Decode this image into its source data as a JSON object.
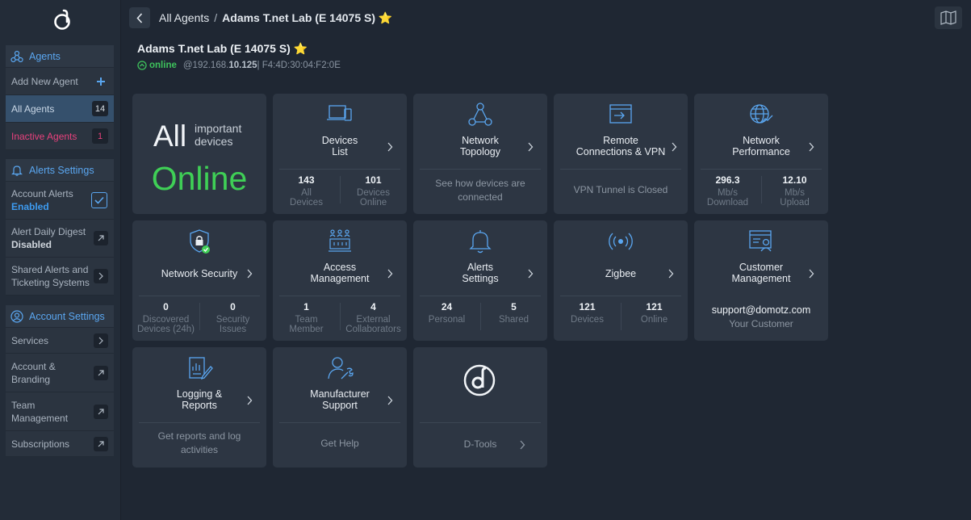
{
  "header": {
    "crumb_root": "All Agents",
    "crumb_sep": "/",
    "crumb_current": "Adams T.net Lab (E 14075 S) ⭐"
  },
  "agent": {
    "title": "Adams T.net Lab (E 14075 S) ⭐",
    "status": "online",
    "ip_prefix": "@192.168.",
    "ip_suffix": "10.125",
    "mac": " | F4:4D:30:04:F2:0E"
  },
  "sidebar": {
    "agents_header": "Agents",
    "add_new_agent": "Add New Agent",
    "all_agents": "All Agents",
    "all_agents_count": "14",
    "inactive_agents": "Inactive Agents",
    "inactive_agents_count": "1",
    "alerts_header": "Alerts Settings",
    "account_alerts": "Account Alerts",
    "account_alerts_state": "Enabled",
    "alert_digest": "Alert Daily Digest",
    "alert_digest_state": "Disabled",
    "shared_alerts_1": "Shared Alerts and",
    "shared_alerts_2": "Ticketing Systems",
    "account_header": "Account Settings",
    "services": "Services",
    "account_branding_1": "Account &",
    "account_branding_2": "Branding",
    "team_mgmt_1": "Team",
    "team_mgmt_2": "Management",
    "subscriptions": "Subscriptions"
  },
  "summary": {
    "all": "All",
    "important_1": "important",
    "important_2": "devices",
    "online": "Online"
  },
  "cards": {
    "devices": {
      "l1": "Devices",
      "l2": "List",
      "s1n": "143",
      "s1a": "All",
      "s1b": "Devices",
      "s2n": "101",
      "s2a": "Devices",
      "s2b": "Online"
    },
    "topology": {
      "l1": "Network",
      "l2": "Topology",
      "n1": "See how devices are",
      "n2": "connected"
    },
    "remote": {
      "l1": "Remote",
      "l2": "Connections & VPN",
      "n1": "VPN Tunnel is Closed"
    },
    "performance": {
      "l1": "Network",
      "l2": "Performance",
      "s1n": "296.3",
      "s1a": "Mb/s",
      "s1b": "Download",
      "s2n": "12.10",
      "s2a": "Mb/s",
      "s2b": "Upload"
    },
    "security": {
      "l1": "Network Security",
      "s1n": "0",
      "s1a": "Discovered",
      "s1b": "Devices (24h)",
      "s2n": "0",
      "s2a": "Security",
      "s2b": "Issues"
    },
    "access": {
      "l1": "Access",
      "l2": "Management",
      "s1n": "1",
      "s1a": "Team",
      "s1b": "Member",
      "s2n": "4",
      "s2a": "External",
      "s2b": "Collaborators"
    },
    "alerts": {
      "l1": "Alerts",
      "l2": "Settings",
      "s1n": "24",
      "s1a": "Personal",
      "s2n": "5",
      "s2a": "Shared"
    },
    "zigbee": {
      "l1": "Zigbee",
      "s1n": "121",
      "s1a": "Devices",
      "s2n": "121",
      "s2a": "Online"
    },
    "customer": {
      "l1": "Customer",
      "l2": "Management",
      "n1": "support@domotz.com",
      "n2": "Your Customer"
    },
    "logging": {
      "l1": "Logging &",
      "l2": "Reports",
      "n1": "Get reports and log",
      "n2": "activities"
    },
    "manufacturer": {
      "l1": "Manufacturer",
      "l2": "Support",
      "n1": "Get Help"
    },
    "dtools": {
      "n1": "D-Tools"
    }
  },
  "colors": {
    "accent": "#5aa6f0",
    "online": "#3fcf56",
    "inactive": "#e8417c"
  }
}
